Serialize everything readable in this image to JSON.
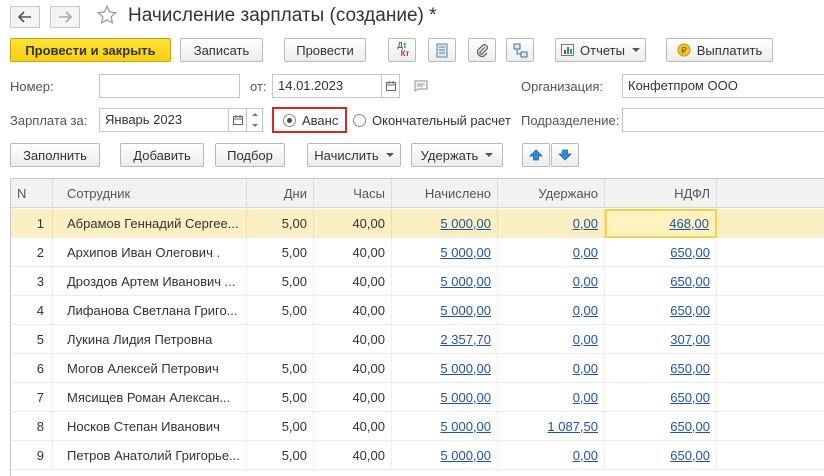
{
  "window": {
    "title": "Начисление зарплаты (создание) *"
  },
  "toolbar": {
    "post_close": "Провести и закрыть",
    "save": "Записать",
    "post": "Провести",
    "dtkt_top": "Дт",
    "dtkt_bottom": "Кт",
    "reports": "Отчеты",
    "pay": "Выплатить"
  },
  "header": {
    "number_label": "Номер:",
    "number_value": "",
    "date_label": "от:",
    "date_value": "14.01.2023",
    "org_label": "Организация:",
    "org_value": "Конфетпром ООО",
    "period_label": "Зарплата за:",
    "period_value": "Январь 2023",
    "radio_advance": "Аванс",
    "radio_final": "Окончательный расчет",
    "dept_label": "Подразделение:",
    "dept_value": ""
  },
  "actions": {
    "fill": "Заполнить",
    "add": "Добавить",
    "pick": "Подбор",
    "accrue": "Начислить",
    "withhold": "Удержать"
  },
  "table": {
    "columns": [
      "N",
      "Сотрудник",
      "Дни",
      "Часы",
      "Начислено",
      "Удержано",
      "НДФЛ"
    ],
    "rows": [
      {
        "n": "1",
        "employee": "Абрамов Геннадий Сергее...",
        "days": "5,00",
        "hours": "40,00",
        "accrued": "5 000,00",
        "withheld": "0,00",
        "ndfl": "468,00"
      },
      {
        "n": "2",
        "employee": "Архипов Иван Олегович .",
        "days": "5,00",
        "hours": "40,00",
        "accrued": "5 000,00",
        "withheld": "0,00",
        "ndfl": "650,00"
      },
      {
        "n": "3",
        "employee": "Дроздов Артем Иванович ...",
        "days": "5,00",
        "hours": "40,00",
        "accrued": "5 000,00",
        "withheld": "0,00",
        "ndfl": "650,00"
      },
      {
        "n": "4",
        "employee": "Лифанова Светлана Григо...",
        "days": "5,00",
        "hours": "40,00",
        "accrued": "5 000,00",
        "withheld": "0,00",
        "ndfl": "650,00"
      },
      {
        "n": "5",
        "employee": "Лукина Лидия Петровна",
        "days": "",
        "hours": "40,00",
        "accrued": "2 357,70",
        "withheld": "0,00",
        "ndfl": "307,00"
      },
      {
        "n": "6",
        "employee": "Могов Алексей Петрович",
        "days": "5,00",
        "hours": "40,00",
        "accrued": "5 000,00",
        "withheld": "0,00",
        "ndfl": "650,00"
      },
      {
        "n": "7",
        "employee": "Мясищев Роман Алексан...",
        "days": "5,00",
        "hours": "40,00",
        "accrued": "5 000,00",
        "withheld": "0,00",
        "ndfl": "650,00"
      },
      {
        "n": "8",
        "employee": "Носков Степан Иванович",
        "days": "5,00",
        "hours": "40,00",
        "accrued": "5 000,00",
        "withheld": "1 087,50",
        "ndfl": "650,00"
      },
      {
        "n": "9",
        "employee": "Петров Анатолий Григорье...",
        "days": "5,00",
        "hours": "40,00",
        "accrued": "5 000,00",
        "withheld": "0,00",
        "ndfl": "650,00"
      }
    ]
  },
  "colors": {
    "primary_button": "#f6cf0f",
    "selected_row": "#fbf0c3",
    "link": "#1f55a6",
    "highlight": "#d4262c"
  }
}
